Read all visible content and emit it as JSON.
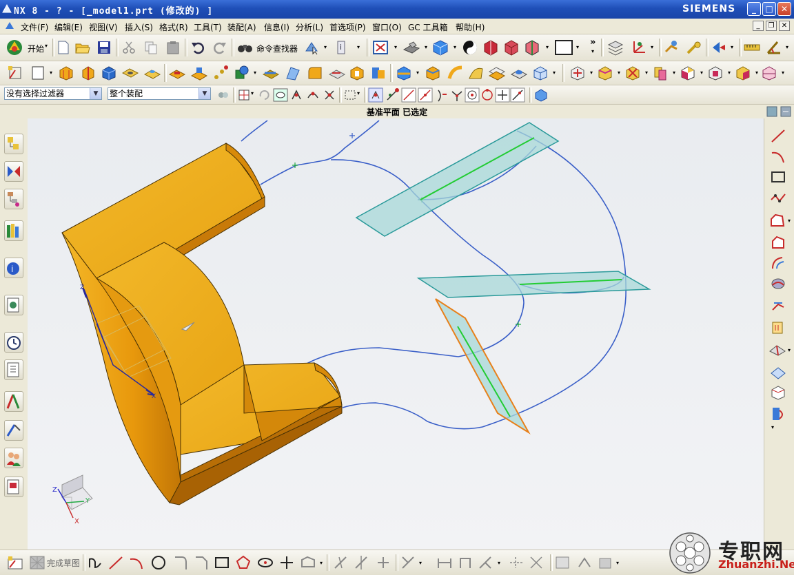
{
  "window": {
    "title": "NX 8 - ? - [_model1.prt  (修改的) ]",
    "brand": "SIEMENS",
    "btn_min": "_",
    "btn_max": "□",
    "btn_close": "✕"
  },
  "menu": {
    "items": [
      "文件(F)",
      "编辑(E)",
      "视图(V)",
      "插入(S)",
      "格式(R)",
      "工具(T)",
      "装配(A)",
      "信息(I)",
      "分析(L)",
      "首选项(P)",
      "窗口(O)",
      "GC 工具箱",
      "帮助(H)"
    ]
  },
  "toolbar1": {
    "start_label": "开始",
    "command_finder_label": "命令查找器",
    "more_glyph": "»"
  },
  "selection": {
    "filter_value": "没有选择过滤器",
    "scope_value": "整个装配"
  },
  "status": {
    "message": "基准平面 已选定"
  },
  "sketch_toolbar": {
    "finish_label": "完成草图"
  },
  "triad": {
    "x": "X",
    "y": "Y",
    "z": "Z"
  },
  "watermark": {
    "cn": "专职网",
    "en": "Zhuanzhi.Net"
  },
  "colors": {
    "titlebar": "#1f4fb8",
    "solid": "#f0a81a",
    "curve": "#3a5fc8",
    "plane_fill": "#a8d8d8",
    "plane_edge": "#2a9a9a",
    "selected_plane_edge": "#e8801a",
    "plane_line": "#22cc33"
  }
}
